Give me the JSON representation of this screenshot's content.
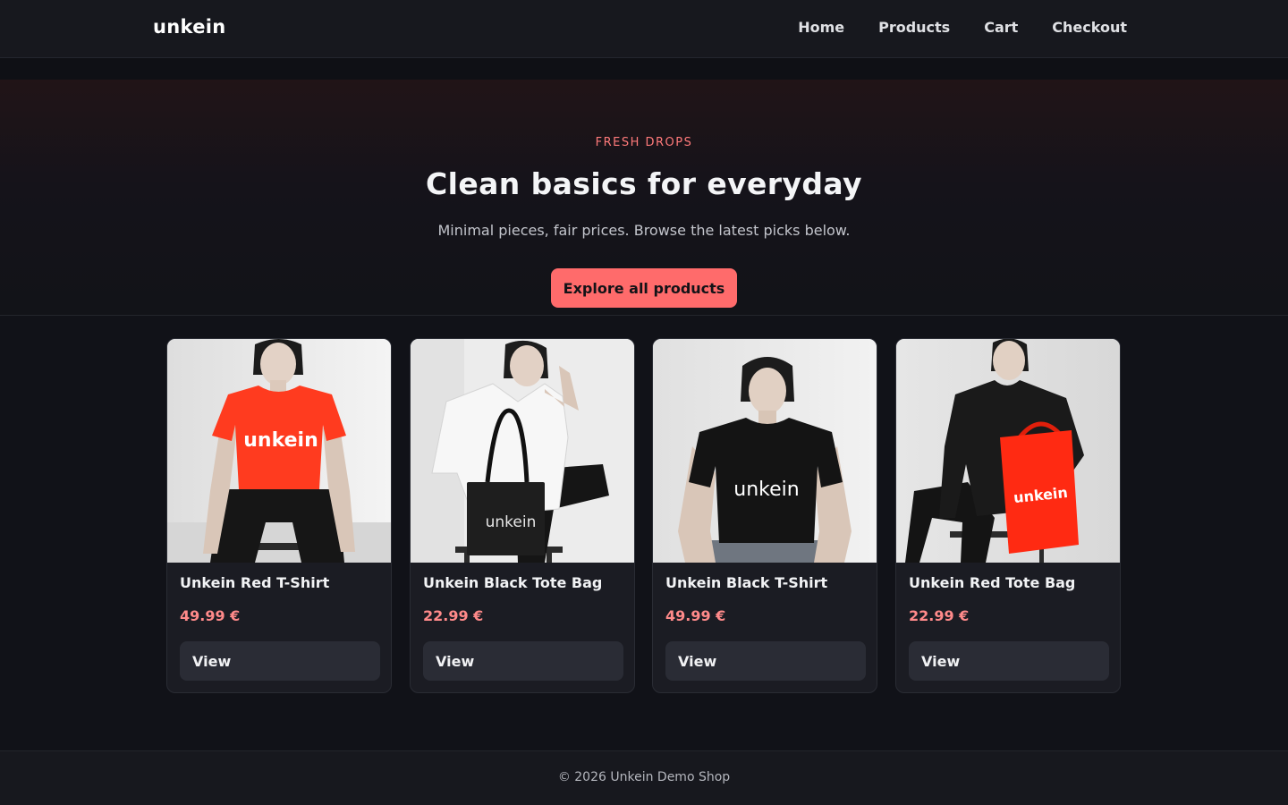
{
  "header": {
    "brand": "unkein",
    "nav": [
      "Home",
      "Products",
      "Cart",
      "Checkout"
    ]
  },
  "hero": {
    "eyebrow": "FRESH DROPS",
    "title": "Clean basics for everyday",
    "subtitle": "Minimal pieces, fair prices. Browse the latest picks below.",
    "cta": "Explore all products"
  },
  "products": [
    {
      "name": "Unkein Red T-Shirt",
      "price": "49.99 €",
      "button": "View",
      "image_text": "unkein"
    },
    {
      "name": "Unkein Black Tote Bag",
      "price": "22.99 €",
      "button": "View",
      "image_text": "unkein"
    },
    {
      "name": "Unkein Black T-Shirt",
      "price": "49.99 €",
      "button": "View",
      "image_text": "unkein"
    },
    {
      "name": "Unkein Red Tote Bag",
      "price": "22.99 €",
      "button": "View",
      "image_text": "unkein"
    }
  ],
  "footer": {
    "text": "© 2026 Unkein Demo Shop"
  },
  "colors": {
    "accent": "#ff6b6b",
    "price": "#ff8a8a",
    "background": "#111218",
    "surface": "#1b1c23",
    "product_red": "#ff3b1f",
    "product_black": "#141414"
  }
}
